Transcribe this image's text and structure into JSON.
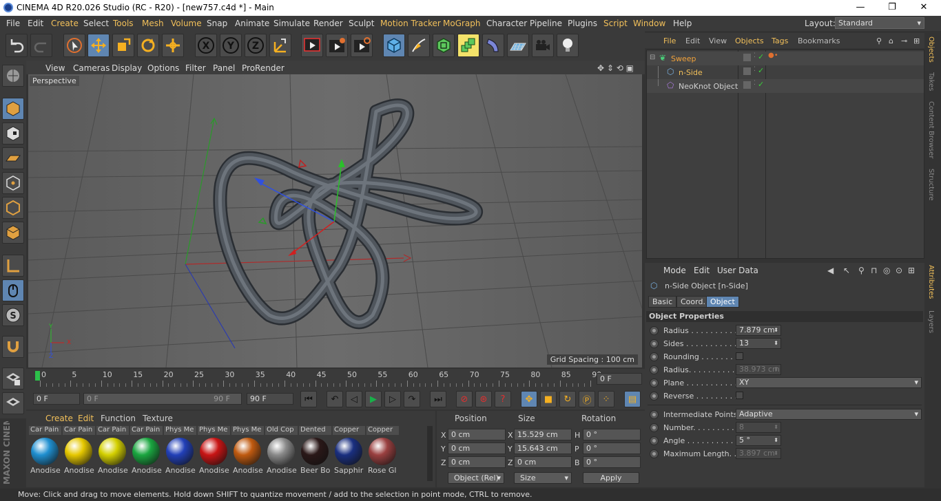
{
  "window": {
    "title": "CINEMA 4D R20.026 Studio (RC - R20) - [new757.c4d *] - Main",
    "minimize": "—",
    "restore": "❐",
    "close": "✕"
  },
  "menubar": {
    "items": [
      "File",
      "Edit",
      "Create",
      "Select",
      "Tools",
      "Mesh",
      "Volume",
      "Snap",
      "Animate",
      "Simulate",
      "Render",
      "Sculpt",
      "Motion Tracker",
      "MoGraph",
      "Character",
      "Pipeline",
      "Plugins",
      "Script",
      "Window",
      "Help"
    ],
    "layout_label": "Layout:",
    "layout_value": "Standard"
  },
  "toolbar": {
    "icons": [
      "undo-icon",
      "redo-icon",
      "live-selection-icon",
      "move-icon",
      "scale-icon",
      "rotate-icon",
      "transform-icon",
      "x-axis-icon",
      "y-axis-icon",
      "z-axis-icon",
      "world-coordinates-icon",
      "render-view-icon",
      "render-picture-viewer-icon",
      "render-settings-icon",
      "cube-icon",
      "pen-icon",
      "subdivision-icon",
      "array-icon",
      "deformer-icon",
      "floor-icon",
      "camera-icon",
      "light-icon"
    ]
  },
  "viewport": {
    "menu": [
      "View",
      "Cameras",
      "Display",
      "Options",
      "Filter",
      "Panel",
      "ProRender"
    ],
    "camera_label": "Perspective",
    "grid_spacing": "Grid Spacing : 100 cm",
    "axis_x": "X",
    "axis_y": "Y",
    "axis_z": "Z"
  },
  "timeline": {
    "ticks": [
      "0",
      "5",
      "10",
      "15",
      "20",
      "25",
      "30",
      "35",
      "40",
      "45",
      "50",
      "55",
      "60",
      "65",
      "70",
      "75",
      "80",
      "85",
      "90"
    ],
    "current_frame": "0 F"
  },
  "transport": {
    "start_frame": "0 F",
    "range_start": "0 F",
    "range_end": "90 F",
    "end_frame": "90 F"
  },
  "materials": {
    "tabs": [
      "Create",
      "Edit",
      "Function",
      "Texture"
    ],
    "items": [
      {
        "top": "Car Pain",
        "bottom": "Anodise",
        "color": "#1f8fd0"
      },
      {
        "top": "Car Pain",
        "bottom": "Anodise",
        "color": "#e6c800"
      },
      {
        "top": "Car Pain",
        "bottom": "Anodise",
        "color": "#d4d000"
      },
      {
        "top": "Car Pain",
        "bottom": "Anodise",
        "color": "#1aa640"
      },
      {
        "top": "Phys Me",
        "bottom": "Anodise",
        "color": "#2240b8"
      },
      {
        "top": "Phys Me",
        "bottom": "Anodise",
        "color": "#c81414"
      },
      {
        "top": "Phys Me",
        "bottom": "Anodise",
        "color": "#c05a10"
      },
      {
        "top": "Old Cop",
        "bottom": "Anodise",
        "color": "#8a8a8a"
      },
      {
        "top": "Dented",
        "bottom": "Beer Bo",
        "color": "#2a1818"
      },
      {
        "top": "Copper",
        "bottom": "Sapphir",
        "color": "#1a2f80"
      },
      {
        "top": "Copper",
        "bottom": "Rose Gl",
        "color": "#9a4040"
      }
    ]
  },
  "coordinates": {
    "headers": [
      "Position",
      "Size",
      "Rotation"
    ],
    "rows": [
      {
        "axis": "X",
        "pos": "0 cm",
        "size_axis": "X",
        "size": "15.529 cm",
        "rot_axis": "H",
        "rot": "0 °"
      },
      {
        "axis": "Y",
        "pos": "0 cm",
        "size_axis": "Y",
        "size": "15.643 cm",
        "rot_axis": "P",
        "rot": "0 °"
      },
      {
        "axis": "Z",
        "pos": "0 cm",
        "size_axis": "Z",
        "size": "0 cm",
        "rot_axis": "B",
        "rot": "0 °"
      }
    ],
    "mode": "Object (Rel)",
    "size_mode": "Size",
    "apply": "Apply"
  },
  "object_manager": {
    "menu": [
      "File",
      "Edit",
      "View",
      "Objects",
      "Tags",
      "Bookmarks"
    ],
    "objects": [
      {
        "name": "Sweep",
        "color": "#f2a23a"
      },
      {
        "name": "n-Side",
        "color": "#f2c05a"
      },
      {
        "name": "NeoKnot Object",
        "color": "#cfcfcf"
      }
    ]
  },
  "attributes": {
    "menu": [
      "Mode",
      "Edit",
      "User Data"
    ],
    "object_title": "n-Side Object [n-Side]",
    "tabs": [
      "Basic",
      "Coord.",
      "Object"
    ],
    "section": "Object Properties",
    "props": [
      {
        "label": "Radius . . . . . . . . . .",
        "value": "7.879 cm",
        "kind": "num"
      },
      {
        "label": "Sides . . . . . . . . . . .",
        "value": "13",
        "kind": "num"
      },
      {
        "label": "Rounding . . . . . . . .",
        "value": "",
        "kind": "check"
      },
      {
        "label": "Radius. . . . . . . . . .",
        "value": "38.973 cm",
        "kind": "dis"
      },
      {
        "label": "Plane . . . . . . . . . . .",
        "value": "XY",
        "kind": "drop"
      },
      {
        "label": "Reverse . . . . . . . . .",
        "value": "",
        "kind": "check"
      }
    ],
    "props2": [
      {
        "label": "Intermediate Points",
        "value": "Adaptive",
        "kind": "drop"
      },
      {
        "label": "Number. . . . . . . . . .",
        "value": "8",
        "kind": "dis"
      },
      {
        "label": "Angle . . . . . . . . . . .",
        "value": "5 °",
        "kind": "num"
      },
      {
        "label": "Maximum Length. .",
        "value": "3.897 cm",
        "kind": "dis"
      }
    ]
  },
  "right_tabs": [
    "Objects",
    "Takes",
    "Content Browser",
    "Structure",
    "Attributes",
    "Layers"
  ],
  "statusbar": "Move: Click and drag to move elements. Hold down SHIFT to quantize movement / add to the selection in point mode, CTRL to remove.",
  "brand": "MAXON CINEMA 4D"
}
